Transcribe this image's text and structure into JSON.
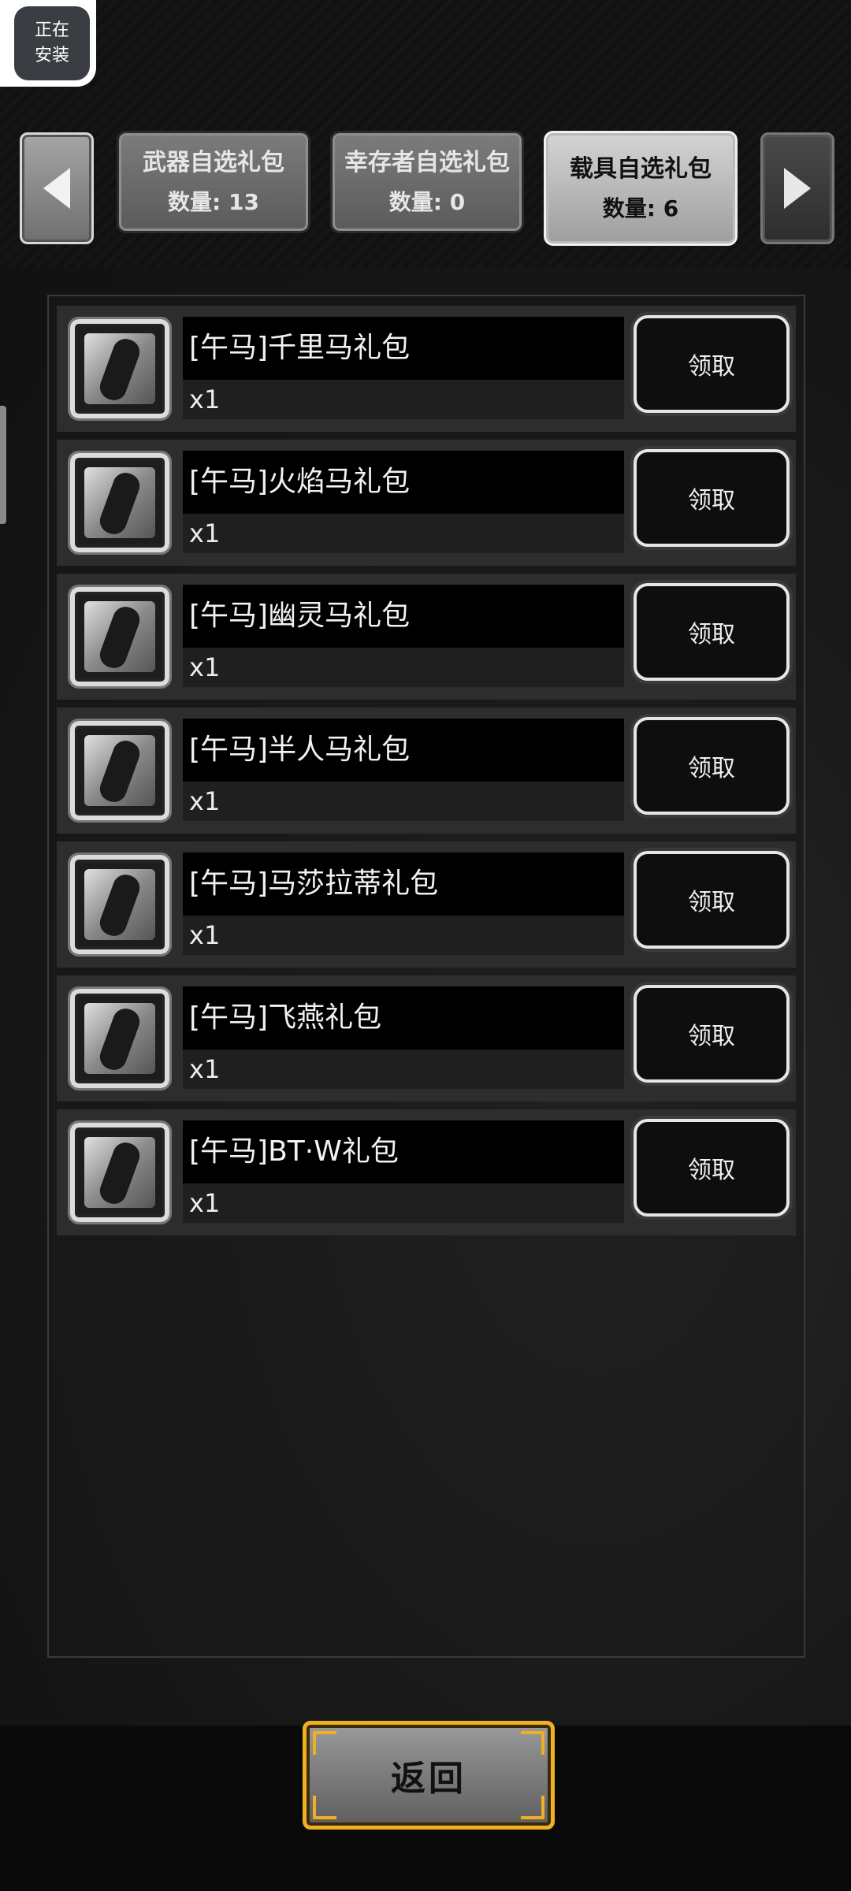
{
  "install_badge": {
    "line1": "正在",
    "line2": "安装"
  },
  "tabs": [
    {
      "name": "武器自选礼包",
      "count": "数量: 13",
      "selected": false
    },
    {
      "name": "幸存者自选礼包",
      "count": "数量: 0",
      "selected": false
    },
    {
      "name": "载具自选礼包",
      "count": "数量: 6",
      "selected": true
    }
  ],
  "items": [
    {
      "name": "[午马]千里马礼包",
      "qty": "x1",
      "action": "领取",
      "icon": "horse-vehicle-icon"
    },
    {
      "name": "[午马]火焰马礼包",
      "qty": "x1",
      "action": "领取",
      "icon": "flame-horse-icon"
    },
    {
      "name": "[午马]幽灵马礼包",
      "qty": "x1",
      "action": "领取",
      "icon": "ghost-horse-icon"
    },
    {
      "name": "[午马]半人马礼包",
      "qty": "x1",
      "action": "领取",
      "icon": "centaur-icon"
    },
    {
      "name": "[午马]马莎拉蒂礼包",
      "qty": "x1",
      "action": "领取",
      "icon": "sports-car-icon"
    },
    {
      "name": "[午马]飞燕礼包",
      "qty": "x1",
      "action": "领取",
      "icon": "motorbike-icon"
    },
    {
      "name": "[午马]BT·W礼包",
      "qty": "x1",
      "action": "领取",
      "icon": "mech-bike-icon"
    }
  ],
  "back_button": {
    "label": "返回"
  },
  "colors": {
    "accent_gold": "#f0b024",
    "panel_bg": "#2d2d2d"
  }
}
